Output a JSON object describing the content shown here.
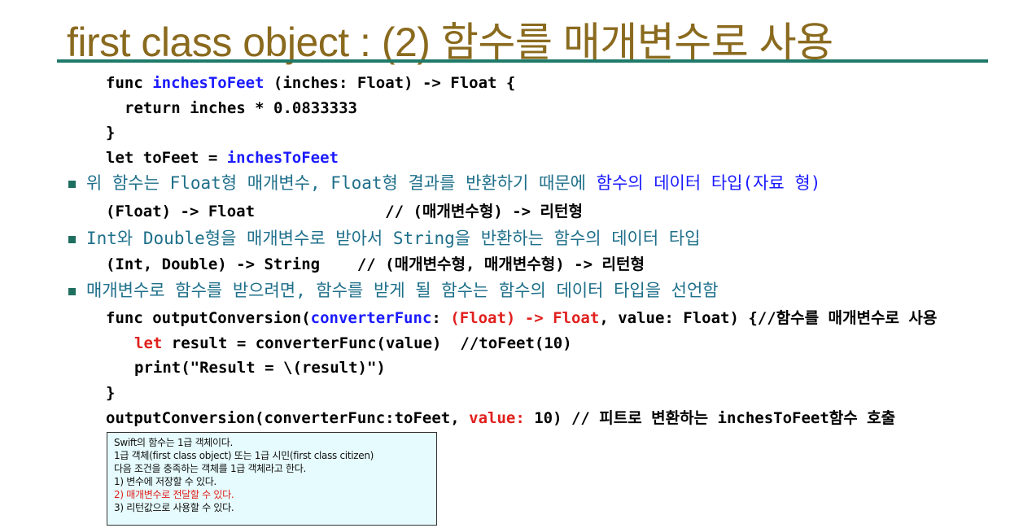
{
  "title": "first class object : (2) 함수를 매개변수로 사용",
  "code1": {
    "l1_a": "func ",
    "l1_b": "inchesToFeet",
    "l1_c": " (inches: Float) -> Float {",
    "l2": "return inches * 0.0833333",
    "l3": "}",
    "l4_a": "let toFeet = ",
    "l4_b": "inchesToFeet"
  },
  "bullet1": {
    "a": "위 함수는 Float형 매개변수, Float형 결과를 반환하기 때문에 ",
    "b": "함수의 데이터 타입(자료 형)"
  },
  "code2": "(Float) -> Float              // (매개변수형) -> 리턴형",
  "bullet2": "Int와 Double형을 매개변수로 받아서 String을 반환하는 함수의 데이터 타입",
  "code3": "(Int, Double) -> String    // (매개변수형, 매개변수형) -> 리턴형",
  "bullet3": "매개변수로 함수를 받으려면, 함수를 받게 될 함수는 함수의 데이터 타입을 선언함",
  "code4": {
    "l1_a": "func outputConversion(",
    "l1_b": "converterFunc",
    "l1_c": ": ",
    "l1_d": "(Float) -> Float",
    "l1_e": ", value: Float) {//함수를 매개변수로 사용",
    "l2_a": "let",
    "l2_b": " result = converterFunc(value)  //toFeet(10)",
    "l3": "print(\"Result = \\(result)\")",
    "l4": "}",
    "l5_a": "outputConversion(converterFunc:toFeet, ",
    "l5_b": "value:",
    "l5_c": " 10) // 피트로 변환하는 inchesToFeet함수 호출"
  },
  "note": {
    "lines": [
      "Swift의 함수는 1급 객체이다.",
      "1급 객체(first class object) 또는 1급 시민(first class citizen)",
      "다음 조건을 충족하는 객체를 1급 객체라고 한다.",
      "1) 변수에 저장할 수 있다.",
      "2) 매개변수로 전달할 수 있다.",
      "3) 리턴값으로 사용할 수 있다."
    ]
  },
  "colors": {
    "title": "#8a6a1e",
    "rule": "#1f7a6a",
    "bullet_text": "#1e6f8a",
    "highlight": "#1a1aff",
    "red": "#e0201e",
    "note_bg": "#e6fbfd"
  }
}
